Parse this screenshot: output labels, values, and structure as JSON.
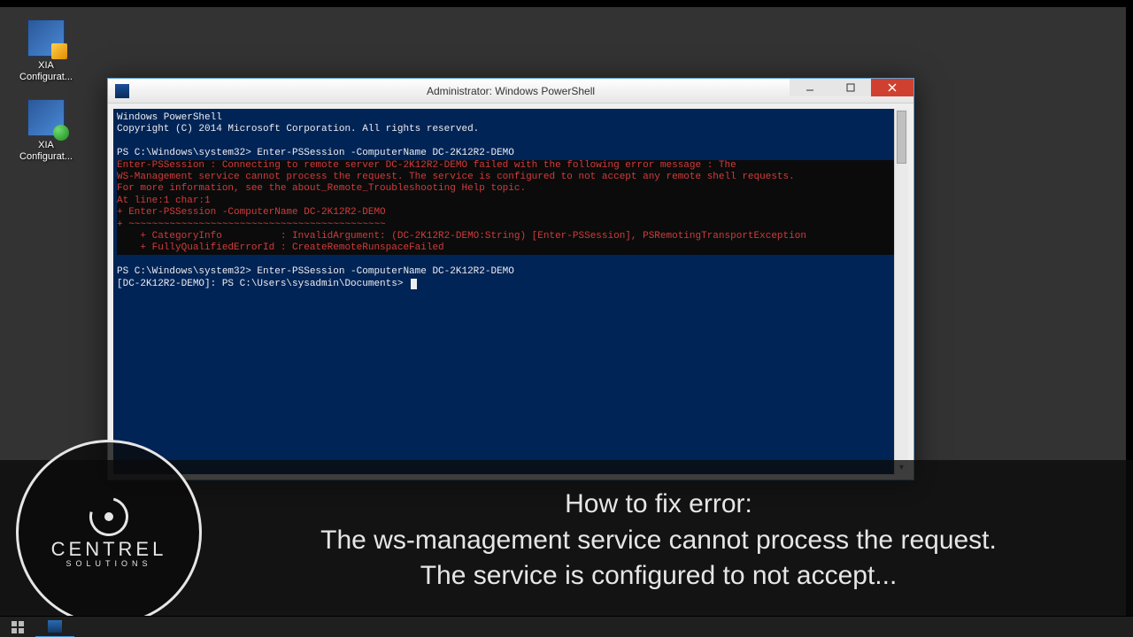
{
  "desktop": {
    "icons": [
      {
        "label": "XIA Configurat...",
        "kind": "shield"
      },
      {
        "label": "XIA Configurat...",
        "kind": "net"
      }
    ]
  },
  "window": {
    "title": "Administrator: Windows PowerShell",
    "terminal": {
      "header1": "Windows PowerShell",
      "header2": "Copyright (C) 2014 Microsoft Corporation. All rights reserved.",
      "prompt1": "PS C:\\Windows\\system32> Enter-PSSession -ComputerName DC-2K12R2-DEMO",
      "error": [
        "Enter-PSSession : Connecting to remote server DC-2K12R2-DEMO failed with the following error message : The",
        "WS-Management service cannot process the request. The service is configured to not accept any remote shell requests.",
        "For more information, see the about_Remote_Troubleshooting Help topic.",
        "At line:1 char:1",
        "+ Enter-PSSession -ComputerName DC-2K12R2-DEMO",
        "+ ~~~~~~~~~~~~~~~~~~~~~~~~~~~~~~~~~~~~~~~~~~~~",
        "    + CategoryInfo          : InvalidArgument: (DC-2K12R2-DEMO:String) [Enter-PSSession], PSRemotingTransportException",
        "    + FullyQualifiedErrorId : CreateRemoteRunspaceFailed"
      ],
      "prompt2": "PS C:\\Windows\\system32> Enter-PSSession -ComputerName DC-2K12R2-DEMO",
      "prompt3": "[DC-2K12R2-DEMO]: PS C:\\Users\\sysadmin\\Documents> "
    }
  },
  "overlay": {
    "logo_main": "CENTREL",
    "logo_sub": "SOLUTIONS",
    "line1": "How to fix error:",
    "line2": "The ws-management service cannot process the request.",
    "line3": "The service is configured to not accept..."
  }
}
